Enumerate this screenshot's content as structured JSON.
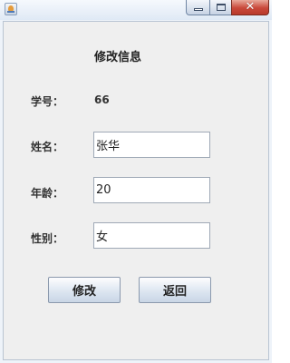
{
  "window": {
    "title": "",
    "icon": "java-cup-icon",
    "caption_buttons": [
      "minimize-icon",
      "maximize-icon",
      "close-icon"
    ]
  },
  "form": {
    "heading": "修改信息",
    "student_id_label": "学号：",
    "student_id_value": "66",
    "name_label": "姓名：",
    "name_value": "张华",
    "age_label": "年龄：",
    "age_value": "20",
    "gender_label": "性别：",
    "gender_value": "女"
  },
  "buttons": {
    "modify": "修改",
    "back": "返回"
  },
  "colors": {
    "window_frame": "#eef3f9",
    "content_bg": "#efefef",
    "close_button": "#c9483a"
  }
}
